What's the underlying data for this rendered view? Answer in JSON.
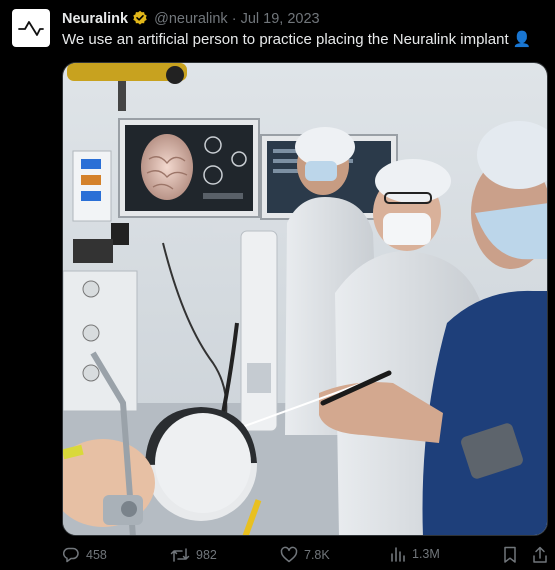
{
  "tweet": {
    "author_name": "Neuralink",
    "handle": "@neuralink",
    "separator": "·",
    "date": "Jul 19, 2023",
    "text": "We use an artificial person to practice placing the Neuralink implant",
    "emoji": "👤",
    "verified_color": "#e2b719"
  },
  "stats": {
    "replies": "458",
    "reposts": "982",
    "likes": "7.8K",
    "views": "1.3M"
  },
  "colors": {
    "background": "#000000",
    "text": "#e7e9ea",
    "muted": "#71767b"
  }
}
